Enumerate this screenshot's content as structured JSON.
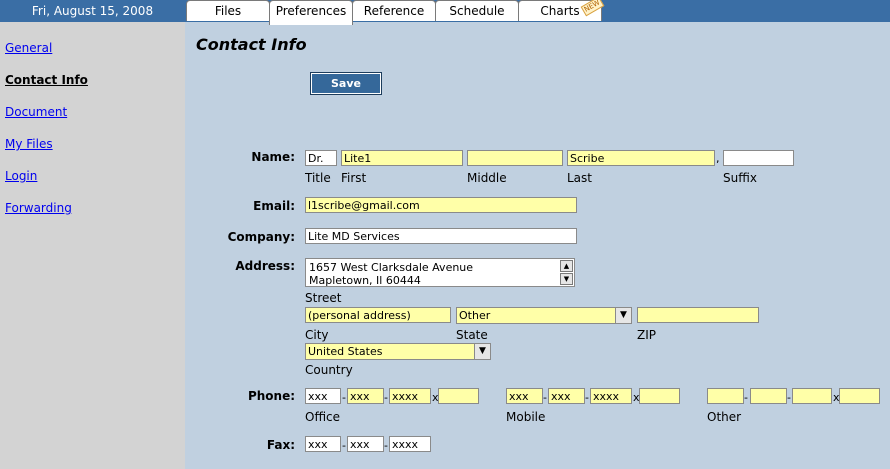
{
  "header": {
    "date": "Fri, August 15, 2008",
    "tabs": [
      {
        "label": "Files"
      },
      {
        "label": "Preferences"
      },
      {
        "label": "Reference"
      },
      {
        "label": "Schedule"
      },
      {
        "label": "Charts"
      }
    ],
    "new_badge": "NEW"
  },
  "sidebar": {
    "items": [
      {
        "label": "General"
      },
      {
        "label": "Contact Info"
      },
      {
        "label": "Document"
      },
      {
        "label": "My Files"
      },
      {
        "label": "Login"
      },
      {
        "label": "Forwarding"
      }
    ]
  },
  "main": {
    "title": "Contact Info",
    "save_label": "Save",
    "name": {
      "label": "Name:",
      "title_value": "Dr.",
      "first_value": "Lite1",
      "middle_value": "",
      "last_value": "Scribe",
      "suffix_value": "",
      "comma": ",",
      "sublabels": {
        "title": "Title",
        "first": "First",
        "middle": "Middle",
        "last": "Last",
        "suffix": "Suffix"
      }
    },
    "email": {
      "label": "Email:",
      "value": "l1scribe@gmail.com"
    },
    "company": {
      "label": "Company:",
      "value": "Lite MD Services"
    },
    "address": {
      "label": "Address:",
      "street_line1": "1657 West Clarksdale Avenue",
      "street_line2": "Mapletown, Il 60444",
      "street_label": "Street",
      "city_value": "(personal address)",
      "city_label": "City",
      "state_value": "Other",
      "state_label": "State",
      "zip_value": "",
      "zip_label": "ZIP",
      "country_value": "United States",
      "country_label": "Country"
    },
    "phone": {
      "label": "Phone:",
      "office": {
        "area": "xxx",
        "prefix": "xxx",
        "line": "xxxx",
        "ext": "",
        "label": "Office"
      },
      "mobile": {
        "area": "xxx",
        "prefix": "xxx",
        "line": "xxxx",
        "ext": "",
        "label": "Mobile"
      },
      "other": {
        "area": "",
        "prefix": "",
        "line": "",
        "ext": "",
        "label": "Other"
      },
      "dash": "-",
      "ext_sep": "x"
    },
    "fax": {
      "label": "Fax:",
      "area": "xxx",
      "prefix": "xxx",
      "line": "xxxx"
    }
  },
  "colors": {
    "topbar": "#3a6ea5",
    "sidebar": "#d3d3d3",
    "content": "#c0d0e0",
    "highlight_field": "#ffffa8",
    "save_button": "#35689a"
  }
}
